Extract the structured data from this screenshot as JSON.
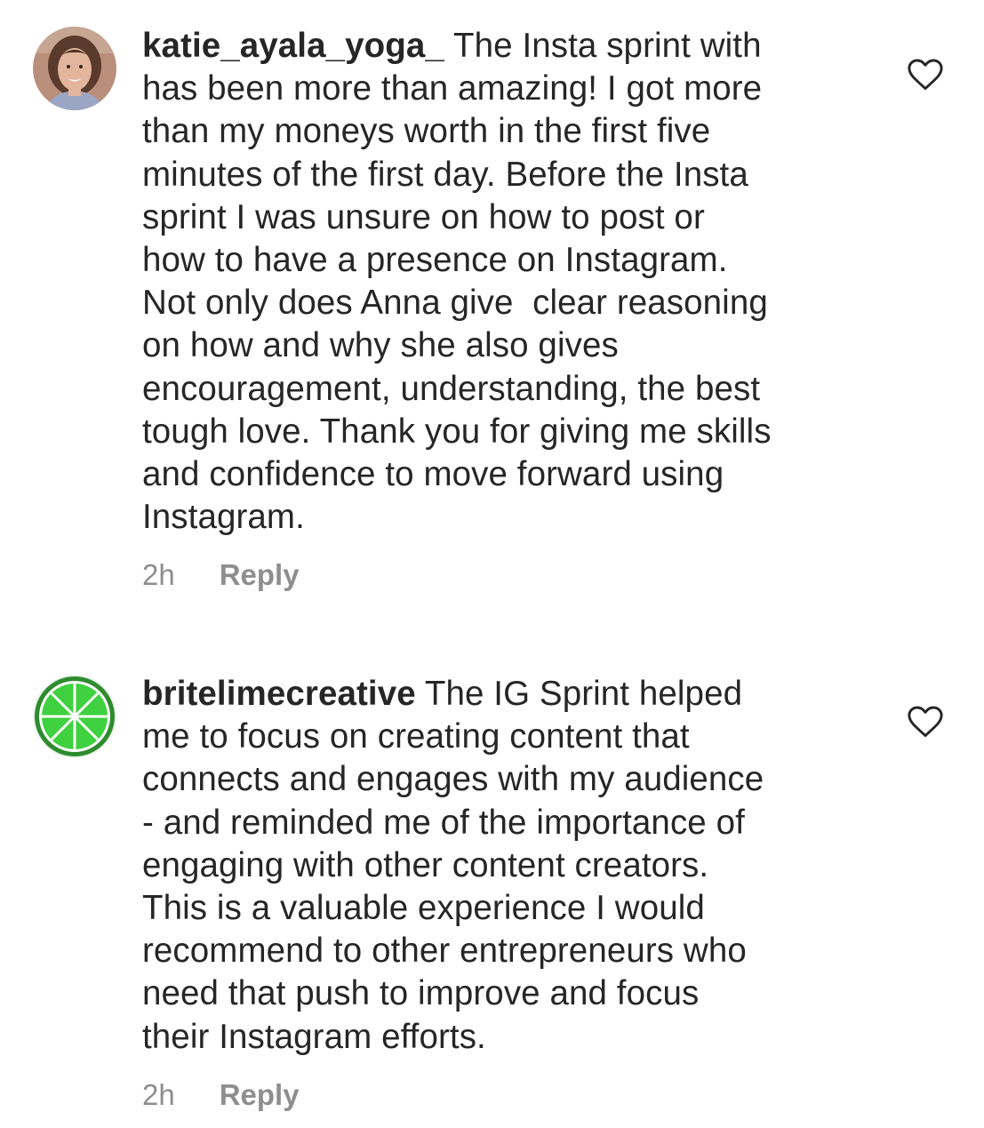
{
  "comments": [
    {
      "avatar_icon": "user-avatar-photo",
      "username": "katie_ayala_yoga_",
      "first_line_rest": " The Insta sprint with",
      "lines": [
        "has been more than amazing! I got more",
        "than my moneys worth in the first five",
        "minutes of the first day. Before the Insta",
        "sprint I was unsure on how to post or",
        "how to have a presence on Instagram.",
        "Not only does Anna give  clear reasoning",
        "on how and why she also gives",
        "encouragement, understanding, the best",
        "tough love. Thank you for giving me skills",
        "and confidence to move forward using",
        "Instagram."
      ],
      "time": "2h",
      "reply_label": "Reply",
      "like_icon": "heart-outline-icon"
    },
    {
      "avatar_icon": "lime-slice-logo",
      "username": "britelimecreative",
      "first_line_rest": " The IG Sprint helped",
      "lines": [
        "me to focus on creating content that",
        "connects and engages with my audience",
        "- and reminded me of the importance of",
        "engaging with other content creators.",
        "This is a valuable experience I would",
        "recommend to other entrepreneurs who",
        "need that push to improve and focus",
        "their Instagram efforts."
      ],
      "time": "2h",
      "reply_label": "Reply",
      "like_icon": "heart-outline-icon"
    }
  ],
  "colors": {
    "text": "#262626",
    "meta": "#8e8e8e",
    "lime_green": "#3fd13f",
    "lime_rim": "#2e8b2e"
  }
}
